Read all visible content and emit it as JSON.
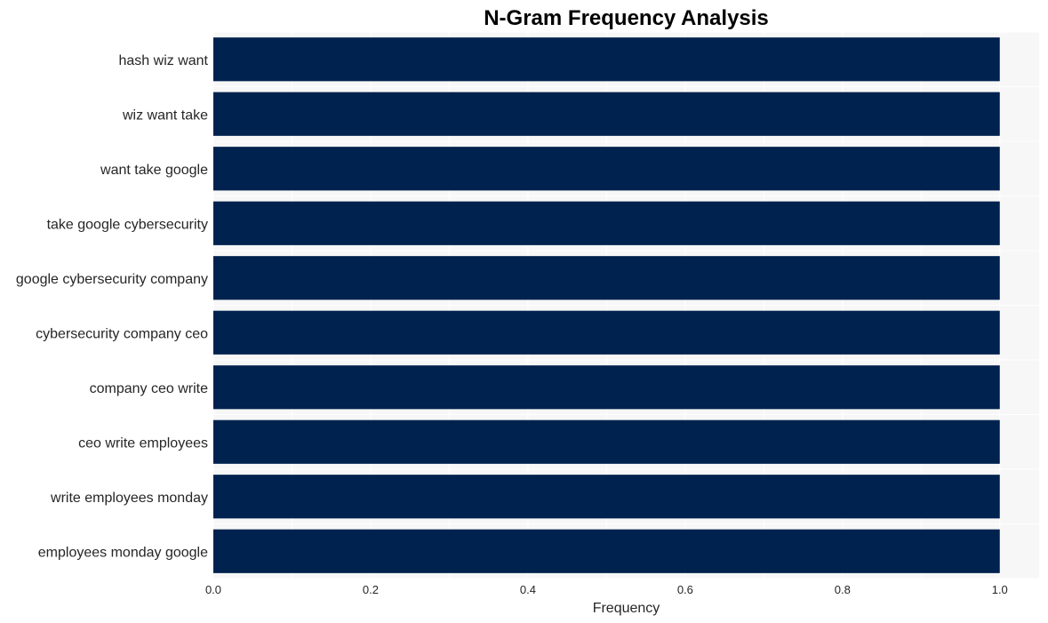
{
  "chart_data": {
    "type": "bar",
    "orientation": "horizontal",
    "title": "N-Gram Frequency Analysis",
    "xlabel": "Frequency",
    "ylabel": "",
    "categories": [
      "hash wiz want",
      "wiz want take",
      "want take google",
      "take google cybersecurity",
      "google cybersecurity company",
      "cybersecurity company ceo",
      "company ceo write",
      "ceo write employees",
      "write employees monday",
      "employees monday google"
    ],
    "values": [
      1,
      1,
      1,
      1,
      1,
      1,
      1,
      1,
      1,
      1
    ],
    "xlim": [
      0,
      1.05
    ],
    "xticks": [
      "0.0",
      "0.2",
      "0.4",
      "0.6",
      "0.8",
      "1.0"
    ],
    "xtick_values": [
      0,
      0.2,
      0.4,
      0.6,
      0.8,
      1.0
    ],
    "grid": true,
    "bar_color": "#00224e",
    "background_color": "#f7f7f7",
    "grid_color": "#ffffff"
  }
}
